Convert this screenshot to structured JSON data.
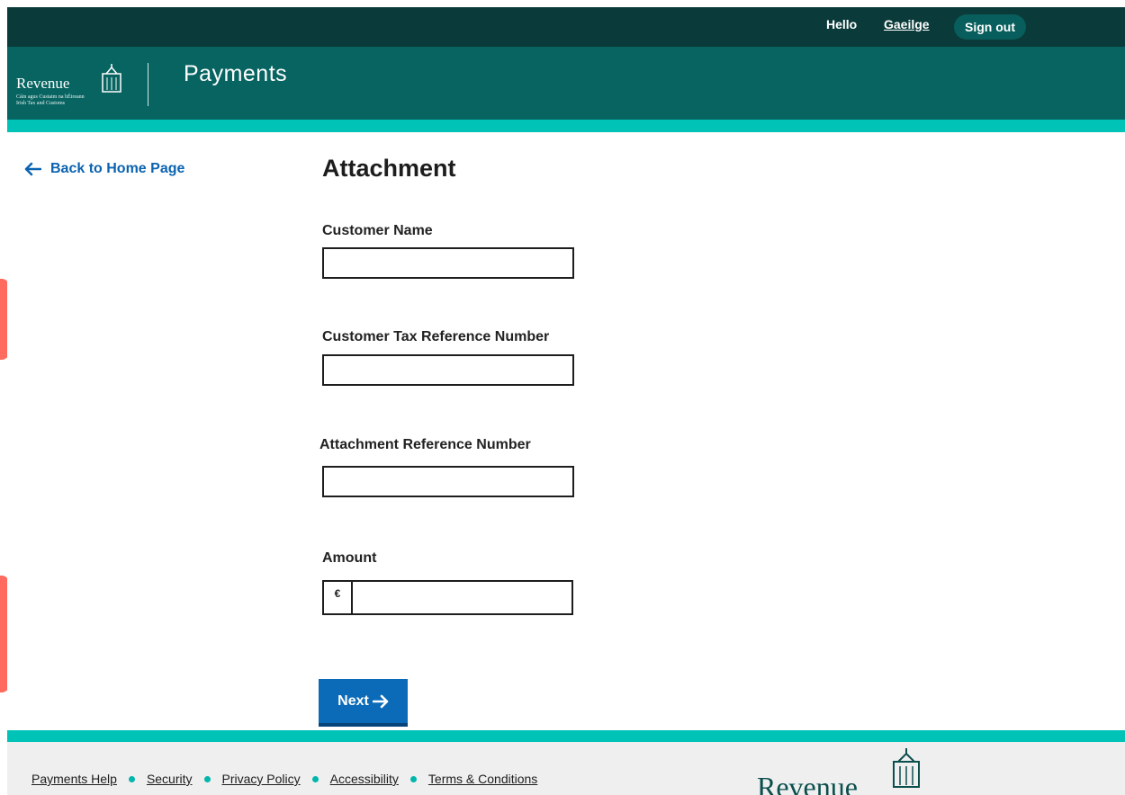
{
  "topbar": {
    "greeting": "Hello",
    "language_link": "Gaeilge",
    "signout_label": "Sign out"
  },
  "header": {
    "logo_word": "Revenue",
    "logo_sub_irish": "Cáin agus Custaim na hÉireann",
    "logo_sub_english": "Irish Tax and Customs",
    "title": "Payments"
  },
  "nav": {
    "back_label": "Back to Home Page"
  },
  "form": {
    "title": "Attachment",
    "customer_name_label": "Customer Name",
    "customer_name_value": "",
    "tax_ref_label": "Customer Tax Reference Number",
    "tax_ref_value": "",
    "attachment_ref_label": "Attachment Reference Number",
    "attachment_ref_value": "",
    "amount_label": "Amount",
    "amount_currency": "€",
    "amount_value": "",
    "next_label": "Next"
  },
  "footer": {
    "links": [
      "Payments Help",
      "Security",
      "Privacy Policy",
      "Accessibility",
      "Terms & Conditions"
    ],
    "logo_word": "Revenue"
  },
  "colors": {
    "topbar": "#0a3b3a",
    "header": "#076461",
    "accent": "#00c3b8",
    "link": "#0b63b0",
    "button": "#0b6bb8"
  },
  "icons": {
    "back": "arrow-left-icon",
    "next": "arrow-right-icon",
    "logo": "harp-icon"
  }
}
